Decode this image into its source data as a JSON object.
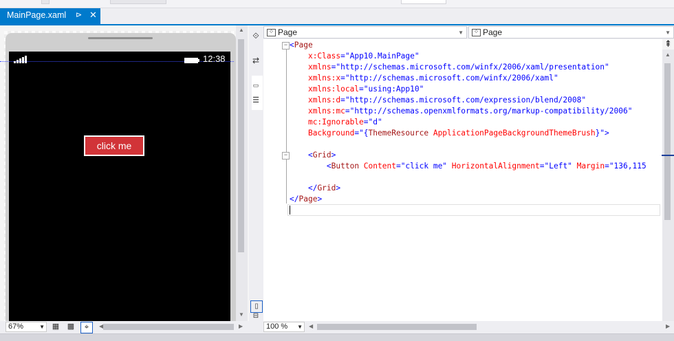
{
  "tab": {
    "title": "MainPage.xaml",
    "pin_glyph": "⊳",
    "close_glyph": "✕"
  },
  "designer": {
    "clock": "12:38",
    "button_label": "click me",
    "zoom": "67%",
    "accent": "#d13438"
  },
  "editor": {
    "selector_left": "Page",
    "selector_right": "Page",
    "zoom": "100 %",
    "lines": [
      [
        {
          "t": "<",
          "c": "brk"
        },
        {
          "t": "Page",
          "c": "tag"
        }
      ],
      [
        {
          "t": "    "
        },
        {
          "t": "x:Class",
          "c": "attr"
        },
        {
          "t": "=\"",
          "c": "val"
        },
        {
          "t": "App10.MainPage",
          "c": "val"
        },
        {
          "t": "\"",
          "c": "val"
        }
      ],
      [
        {
          "t": "    "
        },
        {
          "t": "xmlns",
          "c": "attr"
        },
        {
          "t": "=\"http://schemas.microsoft.com/winfx/2006/xaml/presentation\"",
          "c": "val"
        }
      ],
      [
        {
          "t": "    "
        },
        {
          "t": "xmlns:x",
          "c": "attr"
        },
        {
          "t": "=\"http://schemas.microsoft.com/winfx/2006/xaml\"",
          "c": "val"
        }
      ],
      [
        {
          "t": "    "
        },
        {
          "t": "xmlns:local",
          "c": "attr"
        },
        {
          "t": "=\"using:App10\"",
          "c": "val"
        }
      ],
      [
        {
          "t": "    "
        },
        {
          "t": "xmlns:d",
          "c": "attr"
        },
        {
          "t": "=\"http://schemas.microsoft.com/expression/blend/2008\"",
          "c": "val"
        }
      ],
      [
        {
          "t": "    "
        },
        {
          "t": "xmlns:mc",
          "c": "attr"
        },
        {
          "t": "=\"http://schemas.openxmlformats.org/markup-compatibility/2006\"",
          "c": "val"
        }
      ],
      [
        {
          "t": "    "
        },
        {
          "t": "mc:Ignorable",
          "c": "attr"
        },
        {
          "t": "=\"d\"",
          "c": "val"
        }
      ],
      [
        {
          "t": "    "
        },
        {
          "t": "Background",
          "c": "attr"
        },
        {
          "t": "=\"{",
          "c": "val"
        },
        {
          "t": "ThemeResource",
          "c": "tag"
        },
        {
          "t": " ApplicationPageBackgroundThemeBrush",
          "c": "attr"
        },
        {
          "t": "}\">",
          "c": "val"
        }
      ],
      [
        {
          "t": ""
        }
      ],
      [
        {
          "t": "    "
        },
        {
          "t": "<",
          "c": "brk"
        },
        {
          "t": "Grid",
          "c": "tag"
        },
        {
          "t": ">",
          "c": "brk"
        }
      ],
      [
        {
          "t": "        "
        },
        {
          "t": "<",
          "c": "brk"
        },
        {
          "t": "Button",
          "c": "tag"
        },
        {
          "t": " Content",
          "c": "attr"
        },
        {
          "t": "=\"click me\"",
          "c": "val"
        },
        {
          "t": " HorizontalAlignment",
          "c": "attr"
        },
        {
          "t": "=\"Left\"",
          "c": "val"
        },
        {
          "t": " Margin",
          "c": "attr"
        },
        {
          "t": "=\"136,115",
          "c": "val"
        }
      ],
      [
        {
          "t": ""
        }
      ],
      [
        {
          "t": "    "
        },
        {
          "t": "</",
          "c": "brk"
        },
        {
          "t": "Grid",
          "c": "tag"
        },
        {
          "t": ">",
          "c": "brk"
        }
      ],
      [
        {
          "t": "</",
          "c": "brk"
        },
        {
          "t": "Page",
          "c": "tag"
        },
        {
          "t": ">",
          "c": "brk"
        }
      ]
    ]
  }
}
